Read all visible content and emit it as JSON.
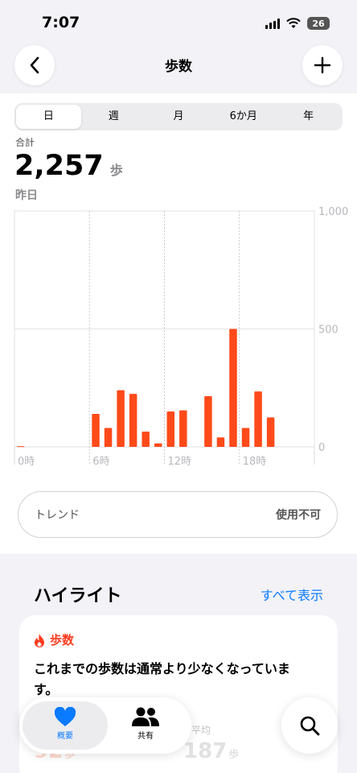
{
  "status": {
    "time": "7:07",
    "battery": "26"
  },
  "nav": {
    "title": "歩数",
    "back_icon": "chevron-left-icon",
    "add_icon": "plus-icon"
  },
  "range_tabs": [
    {
      "label": "日",
      "active": true
    },
    {
      "label": "週",
      "active": false
    },
    {
      "label": "月",
      "active": false
    },
    {
      "label": "6か月",
      "active": false
    },
    {
      "label": "年",
      "active": false
    }
  ],
  "summary": {
    "total_label": "合計",
    "total_value": "2,257",
    "unit": "歩",
    "date": "昨日"
  },
  "chart_data": {
    "type": "bar",
    "x": [
      0,
      6,
      7,
      8,
      9,
      10,
      11,
      12,
      13,
      15,
      16,
      17,
      18,
      19,
      20
    ],
    "values": [
      3,
      140,
      80,
      240,
      225,
      65,
      15,
      150,
      155,
      215,
      40,
      500,
      80,
      235,
      125
    ],
    "x_tick_labels": [
      "0時",
      "6時",
      "12時",
      "18時"
    ],
    "y_tick_labels": [
      "1,000",
      "500",
      "0"
    ],
    "ylim": [
      0,
      1000
    ],
    "xlim": [
      0,
      24
    ],
    "color": "#ff4a1a",
    "grid": true
  },
  "trend": {
    "label": "トレンド",
    "value": "使用不可"
  },
  "highlights": {
    "title": "ハイライト",
    "show_all": "すべて表示",
    "card": {
      "category": "歩数",
      "icon": "flame-icon",
      "message": "これまでの歩数は通常より少なくなっています。",
      "avg_label": "平均",
      "left_value": "92",
      "avg_value": "187",
      "unit": "歩"
    }
  },
  "tabbar": {
    "summary_label": "概要",
    "share_label": "共有",
    "search_icon": "search-icon"
  },
  "colors": {
    "accent": "#0a7aff",
    "bar": "#ff4a1a",
    "background": "#f2f2f7"
  }
}
